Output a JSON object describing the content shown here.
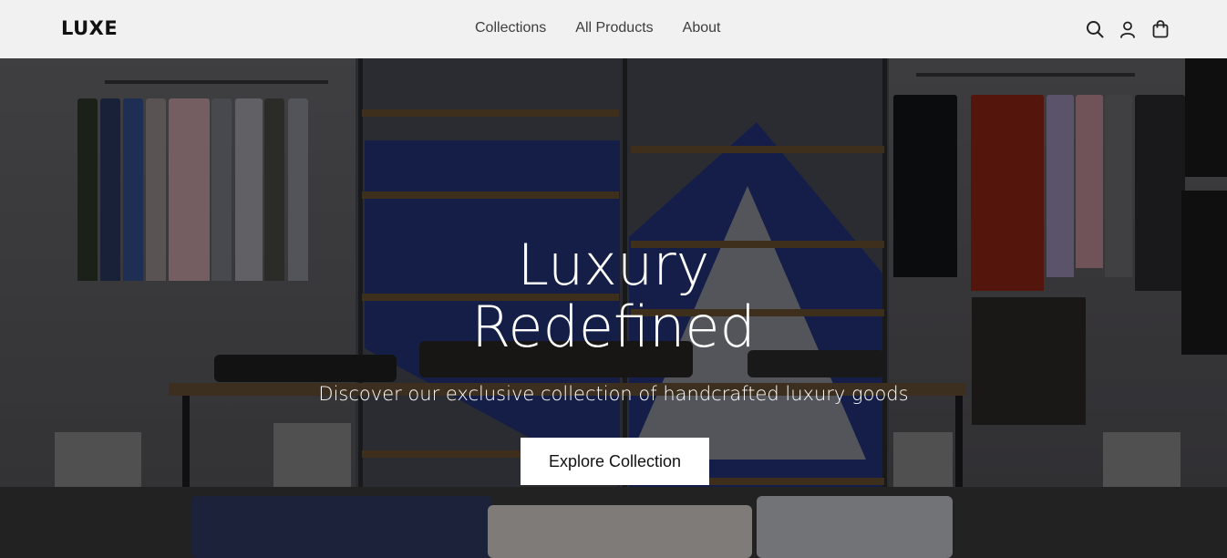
{
  "brand": {
    "logo_text": "LUXE"
  },
  "nav": {
    "links": [
      "Collections",
      "All Products",
      "About"
    ],
    "icons": [
      "search-icon",
      "user-icon",
      "cart-icon"
    ]
  },
  "hero": {
    "title_line1": "Luxury",
    "title_line2": "Redefined",
    "subtitle": "Discover our exclusive collection of handcrafted luxury goods",
    "cta_label": "Explore Collection"
  },
  "colors": {
    "nav_bg": "#fafafa",
    "text_dark": "#111111",
    "cta_bg": "#ffffff"
  }
}
